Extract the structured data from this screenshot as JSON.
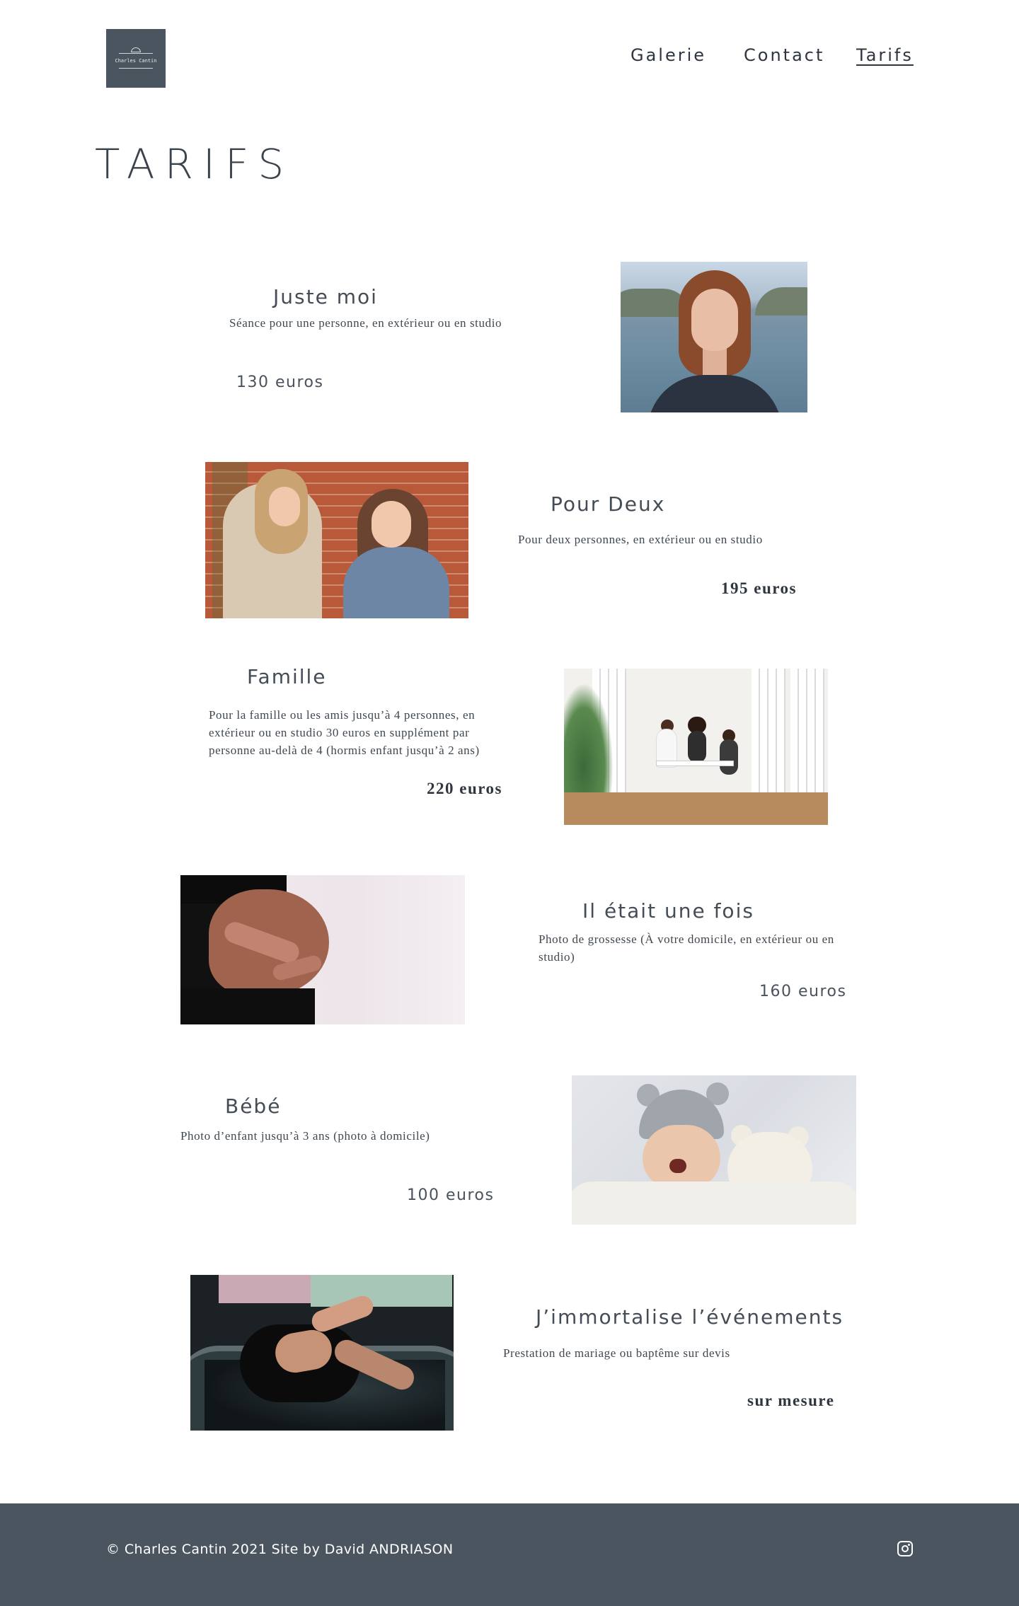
{
  "header": {
    "logo_text": "Charles Cantin",
    "nav": {
      "galerie": "Galerie",
      "contact": "Contact",
      "tarifs": "Tarifs"
    }
  },
  "page_title": "TARIFS",
  "offers": [
    {
      "title": "Juste moi",
      "description": "Séance pour une personne, en extérieur ou en studio",
      "price": "130 euros",
      "image": "portrait-photo"
    },
    {
      "title": "Pour Deux",
      "description": "Pour deux personnes, en extérieur ou en studio",
      "price": "195 euros",
      "image": "two-friends-photo"
    },
    {
      "title": "Famille",
      "description": "Pour la famille ou les amis jusqu’à 4 personnes, en extérieur ou en studio 30 euros en supplément par personne au-delà de 4 (hormis enfant jusqu’à 2 ans)",
      "price": "220 euros",
      "image": "family-photo"
    },
    {
      "title": "Il était une fois",
      "description": "Photo de grossesse (À votre domicile, en extérieur ou en studio)",
      "price": "160 euros",
      "image": "pregnancy-photo"
    },
    {
      "title": "Bébé",
      "description": "Photo d’enfant jusqu’à 3 ans (photo à domicile)",
      "price": "100 euros",
      "image": "baby-photo"
    },
    {
      "title": "J’immortalise l’événements",
      "description": "Prestation de mariage ou baptême sur devis",
      "price": "sur mesure",
      "image": "baptism-photo"
    }
  ],
  "footer": {
    "copyright": "© Charles Cantin 2021 Site by David ANDRIASON",
    "social_icon": "instagram-icon"
  },
  "colors": {
    "brand_slate": "#4a5560",
    "text": "#444c56",
    "background": "#ffffff"
  }
}
